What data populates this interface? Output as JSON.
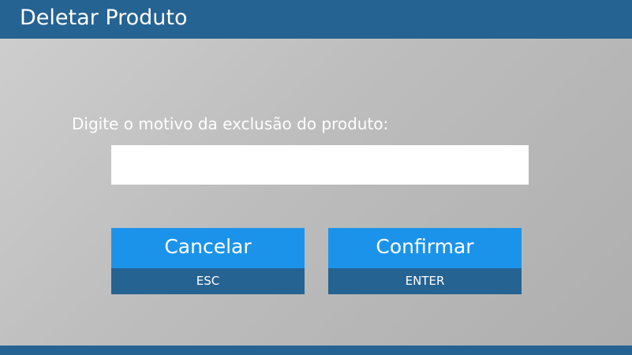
{
  "window": {
    "title": "Deletar Produto"
  },
  "form": {
    "prompt": "Digite o motivo da exclusão do produto:",
    "reason_value": "",
    "reason_placeholder": ""
  },
  "buttons": {
    "cancel": {
      "label": "Cancelar",
      "shortcut": "ESC"
    },
    "confirm": {
      "label": "Confirmar",
      "shortcut": "ENTER"
    }
  },
  "colors": {
    "header": "#256392",
    "button_primary": "#1b93eb",
    "button_shortcut": "#256392",
    "background_gradient_start": "#cfcfcf",
    "background_gradient_end": "#aeaeae"
  }
}
